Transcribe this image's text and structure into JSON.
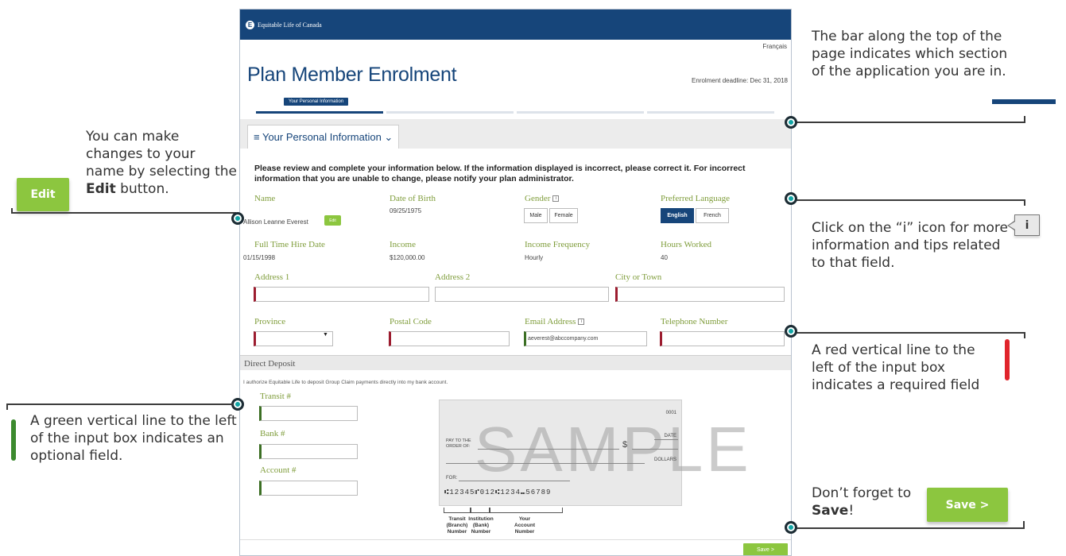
{
  "app": {
    "brand": "Equitable Life of Canada",
    "lang_toggle": "Français",
    "title": "Plan Member Enrolment",
    "deadline": "Enrolment deadline: Dec 31, 2018",
    "step_label": "Your Personal Information",
    "section_tab": "≡ Your Personal Information ⌄",
    "intro": "Please review and complete your information below. If the information displayed is incorrect, please correct it. For incorrect information that you are unable to change, please notify your plan administrator.",
    "fields": {
      "name_label": "Name",
      "name_value": "Allison Leanne Everest",
      "edit_label": "Edit",
      "dob_label": "Date of Birth",
      "dob_value": "09/25/1975",
      "gender_label": "Gender",
      "gender_male": "Male",
      "gender_female": "Female",
      "lang_label": "Preferred Language",
      "lang_english": "English",
      "lang_french": "French",
      "hire_label": "Full Time Hire Date",
      "hire_value": "01/15/1998",
      "income_label": "Income",
      "income_value": "$120,000.00",
      "freq_label": "Income Frequency",
      "freq_value": "Hourly",
      "hours_label": "Hours Worked",
      "hours_value": "40",
      "address1_label": "Address 1",
      "address2_label": "Address 2",
      "city_label": "City or Town",
      "province_label": "Province",
      "postal_label": "Postal Code",
      "email_label": "Email Address",
      "email_value": "aeverest@abccompany.com",
      "phone_label": "Telephone Number"
    },
    "direct_deposit": {
      "title": "Direct Deposit",
      "authorize": "I authorize Equitable Life to deposit Group Claim payments directly into my bank account.",
      "transit_label": "Transit #",
      "bank_label": "Bank #",
      "account_label": "Account #"
    },
    "cheque": {
      "number": "0001",
      "date": "DATE",
      "pay_to": "PAY TO THE ORDER OF:",
      "dollar_sign": "$",
      "dollars": "DOLLARS",
      "for": "FOR:",
      "micr": "⑆12345⑈012⑆1234⑉56789",
      "watermark": "SAMPLE",
      "cap_transit": "Transit (Branch) Number",
      "cap_institution": "Institution (Bank) Number",
      "cap_account": "Your Account Number"
    },
    "save_label": "Save >"
  },
  "annotations": {
    "edit_note_a": "You can make changes to your name by selecting the ",
    "edit_note_b": "Edit",
    "edit_note_c": " button.",
    "edit_button": "Edit",
    "top_bar_note": "The bar along the top of the page indicates which section of the application you are in.",
    "info_note": "Click on the “i” icon for more information and tips related to that field.",
    "info_icon": "i",
    "red_note": "A red vertical line to the left of the input box indicates a required field",
    "green_note": "A green vertical line to the left of the input box indicates an optional field.",
    "save_note_a": "Don’t forget to ",
    "save_note_b": "Save",
    "save_note_c": "!",
    "save_button": "Save >"
  },
  "colors": {
    "brand_blue": "#16457a",
    "accent_green": "#8cc63f",
    "required_red": "#9c1c2f",
    "optional_green": "#3c6f24",
    "connector_teal": "#11a5a5"
  }
}
